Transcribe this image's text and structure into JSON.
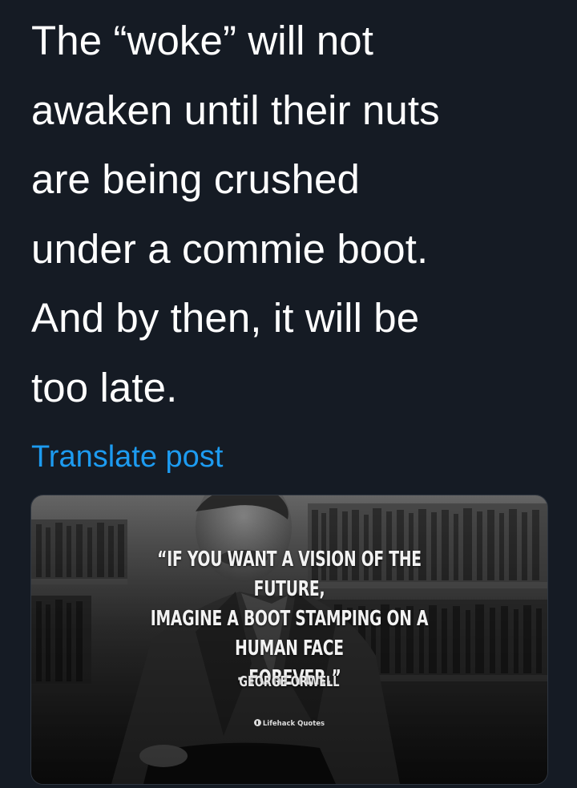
{
  "post": {
    "text": "The “woke” will not\nawaken until their nuts\nare being crushed\nunder a commie boot.\nAnd by then, it will be\ntoo late.",
    "translate_label": "Translate post"
  },
  "media": {
    "quote": "“If you want a vision of the future,\nimagine a boot stamping on a human face\n- forever.”",
    "author": "George Orwell",
    "watermark": "Lifehack Quotes"
  },
  "colors": {
    "background": "#151b24",
    "text": "#ffffff",
    "link": "#1d9bf0"
  }
}
